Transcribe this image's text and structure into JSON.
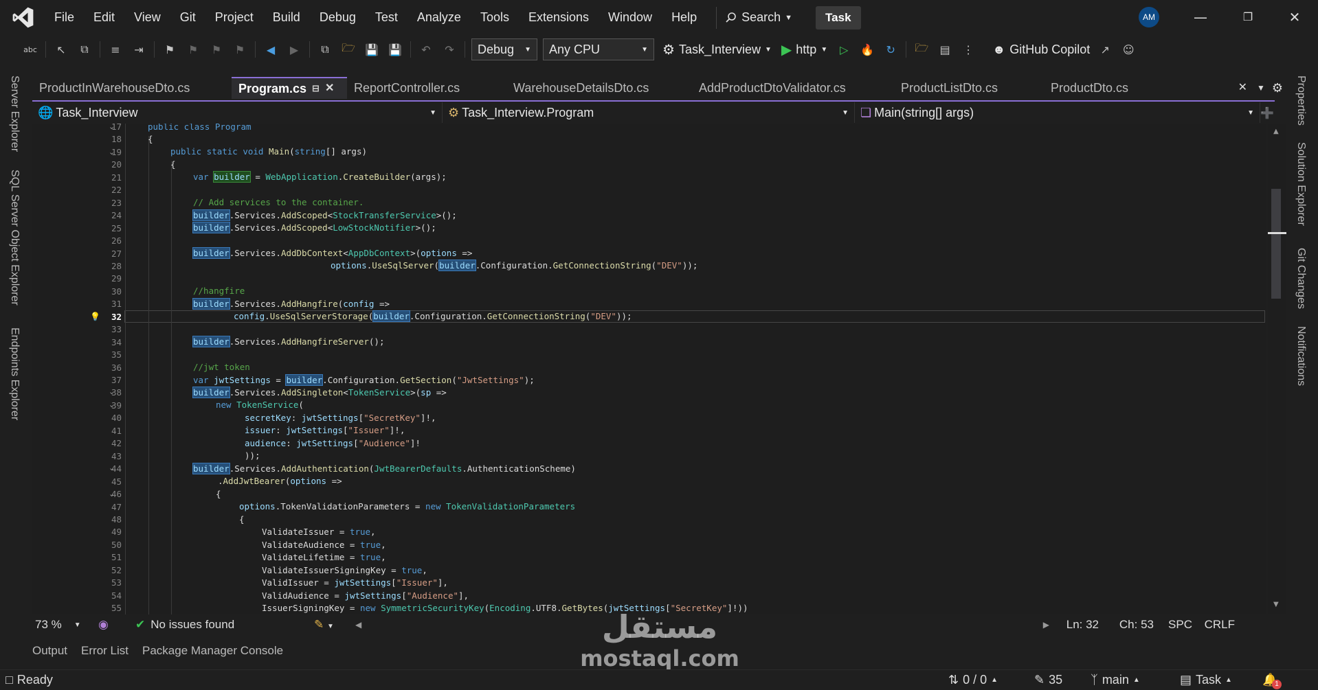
{
  "menu": [
    "File",
    "Edit",
    "View",
    "Git",
    "Project",
    "Build",
    "Debug",
    "Test",
    "Analyze",
    "Tools",
    "Extensions",
    "Window",
    "Help"
  ],
  "search_label": "Search",
  "solution_badge": "Task",
  "avatar_initials": "AM",
  "toolbar": {
    "config": "Debug",
    "platform": "Any CPU",
    "startup_project": "Task_Interview",
    "run_profile": "http",
    "copilot_label": "GitHub Copilot"
  },
  "left_rail": [
    "Server Explorer",
    "SQL Server Object Explorer",
    "Endpoints Explorer"
  ],
  "right_rail": [
    "Properties",
    "Solution Explorer",
    "Git Changes",
    "Notifications"
  ],
  "doc_tabs": [
    {
      "label": "ProductInWarehouseDto.cs",
      "active": false
    },
    {
      "label": "Program.cs",
      "active": true
    },
    {
      "label": "ReportController.cs",
      "active": false
    },
    {
      "label": "WarehouseDetailsDto.cs",
      "active": false
    },
    {
      "label": "AddProductDtoValidator.cs",
      "active": false
    },
    {
      "label": "ProductListDto.cs",
      "active": false
    },
    {
      "label": "ProductDto.cs",
      "active": false
    }
  ],
  "navbar": {
    "project": "Task_Interview",
    "type": "Task_Interview.Program",
    "member": "Main(string[] args)"
  },
  "code": {
    "current_line": 32,
    "line_numbers": [
      "17",
      "18",
      "19",
      "20",
      "21",
      "22",
      "23",
      "24",
      "25",
      "26",
      "27",
      "28",
      "29",
      "30",
      "31",
      "32",
      "33",
      "34",
      "35",
      "36",
      "37",
      "38",
      "39",
      "40",
      "41",
      "42",
      "43",
      "44",
      "45",
      "46",
      "47",
      "48",
      "49",
      "50",
      "51",
      "52",
      "53",
      "54",
      "55"
    ],
    "l17": "public class Program",
    "l18": "{",
    "l19_a": "public static void ",
    "l19_b": "Main",
    "l19_c": "(",
    "l19_d": "string",
    "l19_e": "[] args)",
    "l20": "{",
    "l21_a": "var ",
    "l21_b": "builder",
    "l21_c": " = ",
    "l21_d": "WebApplication",
    "l21_e": ".",
    "l21_f": "CreateBuilder",
    "l21_g": "(args);",
    "l23": "// Add services to the container.",
    "l24_a": "builder",
    "l24_b": ".Services.",
    "l24_c": "AddScoped",
    "l24_d": "<",
    "l24_e": "StockTransferService",
    "l24_f": ">();",
    "l25_a": "builder",
    "l25_b": ".Services.",
    "l25_c": "AddScoped",
    "l25_d": "<",
    "l25_e": "LowStockNotifier",
    "l25_f": ">();",
    "l27_a": "builder",
    "l27_b": ".Services.",
    "l27_c": "AddDbContext",
    "l27_d": "<",
    "l27_e": "AppDbContext",
    "l27_f": ">(",
    "l27_g": "options",
    "l27_h": " =>",
    "l28_a": "options",
    "l28_b": ".",
    "l28_c": "UseSqlServer",
    "l28_d": "(",
    "l28_e": "builder",
    "l28_f": ".Configuration.",
    "l28_g": "GetConnectionString",
    "l28_h": "(",
    "l28_i": "\"DEV\"",
    "l28_j": "));",
    "l30": "//hangfire",
    "l31_a": "builder",
    "l31_b": ".Services.",
    "l31_c": "AddHangfire",
    "l31_d": "(",
    "l31_e": "config",
    "l31_f": " =>",
    "l32_a": "config",
    "l32_b": ".",
    "l32_c": "UseSqlServerStorage",
    "l32_d": "(",
    "l32_e": "builder",
    "l32_f": ".Configuration.",
    "l32_g": "GetConnectionString",
    "l32_h": "(",
    "l32_i": "\"DEV\"",
    "l32_j": "));",
    "l34_a": "builder",
    "l34_b": ".Services.",
    "l34_c": "AddHangfireServer",
    "l34_d": "();",
    "l36": "//jwt token",
    "l37_a": "var ",
    "l37_b": "jwtSettings",
    "l37_c": " = ",
    "l37_d": "builder",
    "l37_e": ".Configuration.",
    "l37_f": "GetSection",
    "l37_g": "(",
    "l37_h": "\"JwtSettings\"",
    "l37_i": ");",
    "l38_a": "builder",
    "l38_b": ".Services.",
    "l38_c": "AddSingleton",
    "l38_d": "<",
    "l38_e": "TokenService",
    "l38_f": ">(",
    "l38_g": "sp",
    "l38_h": " =>",
    "l39_a": "new ",
    "l39_b": "TokenService",
    "l39_c": "(",
    "l40_a": "secretKey",
    "l40_b": ": ",
    "l40_c": "jwtSettings",
    "l40_d": "[",
    "l40_e": "\"SecretKey\"",
    "l40_f": "]!,",
    "l41_a": "issuer",
    "l41_b": ": ",
    "l41_c": "jwtSettings",
    "l41_d": "[",
    "l41_e": "\"Issuer\"",
    "l41_f": "]!,",
    "l42_a": "audience",
    "l42_b": ": ",
    "l42_c": "jwtSettings",
    "l42_d": "[",
    "l42_e": "\"Audience\"",
    "l42_f": "]!",
    "l43": "));",
    "l44_a": "builder",
    "l44_b": ".Services.",
    "l44_c": "AddAuthentication",
    "l44_d": "(",
    "l44_e": "JwtBearerDefaults",
    "l44_f": ".AuthenticationScheme)",
    "l45_a": ".",
    "l45_b": "AddJwtBearer",
    "l45_c": "(",
    "l45_d": "options",
    "l45_e": " =>",
    "l46": "{",
    "l47_a": "options",
    "l47_b": ".TokenValidationParameters = ",
    "l47_c": "new ",
    "l47_d": "TokenValidationParameters",
    "l48": "{",
    "l49_a": "ValidateIssuer = ",
    "l49_b": "true",
    "l49_c": ",",
    "l50_a": "ValidateAudience = ",
    "l50_b": "true",
    "l50_c": ",",
    "l51_a": "ValidateLifetime = ",
    "l51_b": "true",
    "l51_c": ",",
    "l52_a": "ValidateIssuerSigningKey = ",
    "l52_b": "true",
    "l52_c": ",",
    "l53_a": "ValidIssuer = ",
    "l53_b": "jwtSettings",
    "l53_c": "[",
    "l53_d": "\"Issuer\"",
    "l53_e": "],",
    "l54_a": "ValidAudience = ",
    "l54_b": "jwtSettings",
    "l54_c": "[",
    "l54_d": "\"Audience\"",
    "l54_e": "],",
    "l55_a": "IssuerSigningKey = ",
    "l55_b": "new ",
    "l55_c": "SymmetricSecurityKey",
    "l55_d": "(",
    "l55_e": "Encoding",
    "l55_f": ".UTF8.",
    "l55_g": "GetBytes",
    "l55_h": "(",
    "l55_i": "jwtSettings",
    "l55_j": "[",
    "l55_k": "\"SecretKey\"",
    "l55_l": "]!))"
  },
  "editor_bar": {
    "zoom": "73 %",
    "issues": "No issues found",
    "line": "Ln: 32",
    "col": "Ch: 53",
    "spacing": "SPC",
    "line_ending": "CRLF"
  },
  "panel_tabs": [
    "Output",
    "Error List",
    "Package Manager Console"
  ],
  "status": {
    "ready": "Ready",
    "sync": "0 / 0",
    "changes": "35",
    "branch": "main",
    "repo": "Task",
    "notifications": "1"
  },
  "watermark": {
    "arabic": "مستقل",
    "latin": "mostaql.com"
  },
  "colors": {
    "accent": "#8a6fd6",
    "run_green": "#3cc454",
    "selection": "#264f78"
  }
}
